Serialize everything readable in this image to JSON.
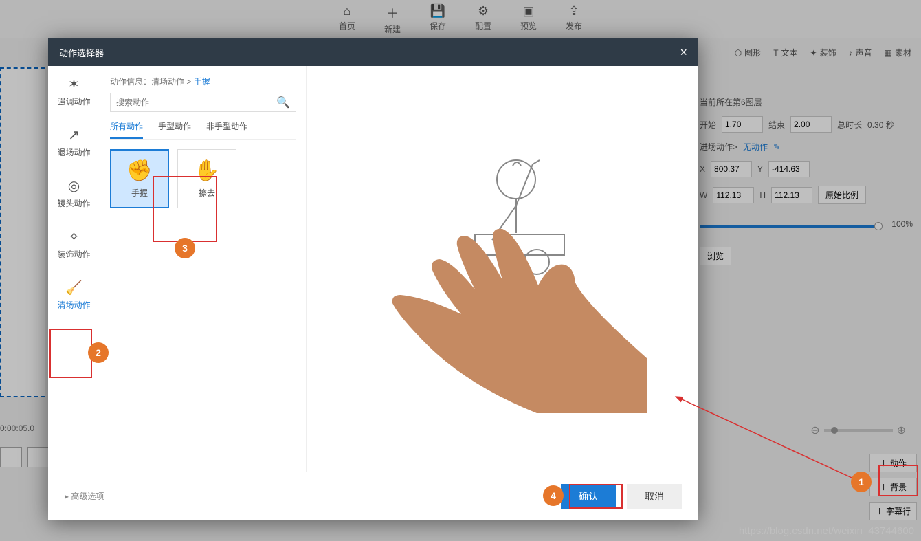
{
  "toolbar": {
    "items": [
      {
        "label": "首页"
      },
      {
        "label": "新建"
      },
      {
        "label": "保存"
      },
      {
        "label": "配置"
      },
      {
        "label": "预览"
      },
      {
        "label": "发布"
      }
    ]
  },
  "sec_toolbar": [
    {
      "label": "图形"
    },
    {
      "label": "文本"
    },
    {
      "label": "装饰"
    },
    {
      "label": "声音"
    },
    {
      "label": "素材"
    }
  ],
  "timecode": "0:00:05.0",
  "right_panel": {
    "layer_text": "当前所在第6图层",
    "start_label": "开始",
    "start_value": "1.70",
    "end_label": "结束",
    "end_value": "2.00",
    "total_label": "总时长",
    "total_value": "0.30 秒",
    "enter_label": "进场动作>",
    "enter_value": "无动作",
    "x_label": "X",
    "x_value": "800.37",
    "y_label": "Y",
    "y_value": "-414.63",
    "w_label": "W",
    "w_value": "112.13",
    "h_label": "H",
    "h_value": "112.13",
    "orig_ratio": "原始比例",
    "zoom_pct": "100%",
    "browse": "浏览"
  },
  "right_acts": {
    "action": "动作",
    "bg": "背景",
    "subtitle": "字幕行"
  },
  "modal": {
    "title": "动作选择器",
    "close": "×",
    "categories": [
      {
        "label": "强调动作"
      },
      {
        "label": "退场动作"
      },
      {
        "label": "镜头动作"
      },
      {
        "label": "装饰动作"
      },
      {
        "label": "清场动作"
      }
    ],
    "breadcrumb_prefix": "动作信息：",
    "breadcrumb_cat": "清场动作",
    "breadcrumb_sep": " > ",
    "breadcrumb_cur": "手握",
    "search_placeholder": "搜索动作",
    "tabs": [
      {
        "label": "所有动作"
      },
      {
        "label": "手型动作"
      },
      {
        "label": "非手型动作"
      }
    ],
    "actions": [
      {
        "label": "手握"
      },
      {
        "label": "擦去"
      }
    ],
    "advanced": "高级选项",
    "confirm": "确认",
    "cancel": "取消"
  },
  "callouts": {
    "c1": "1",
    "c2": "2",
    "c3": "3",
    "c4": "4"
  },
  "watermark": "https://blog.csdn.net/weixin_43744600"
}
